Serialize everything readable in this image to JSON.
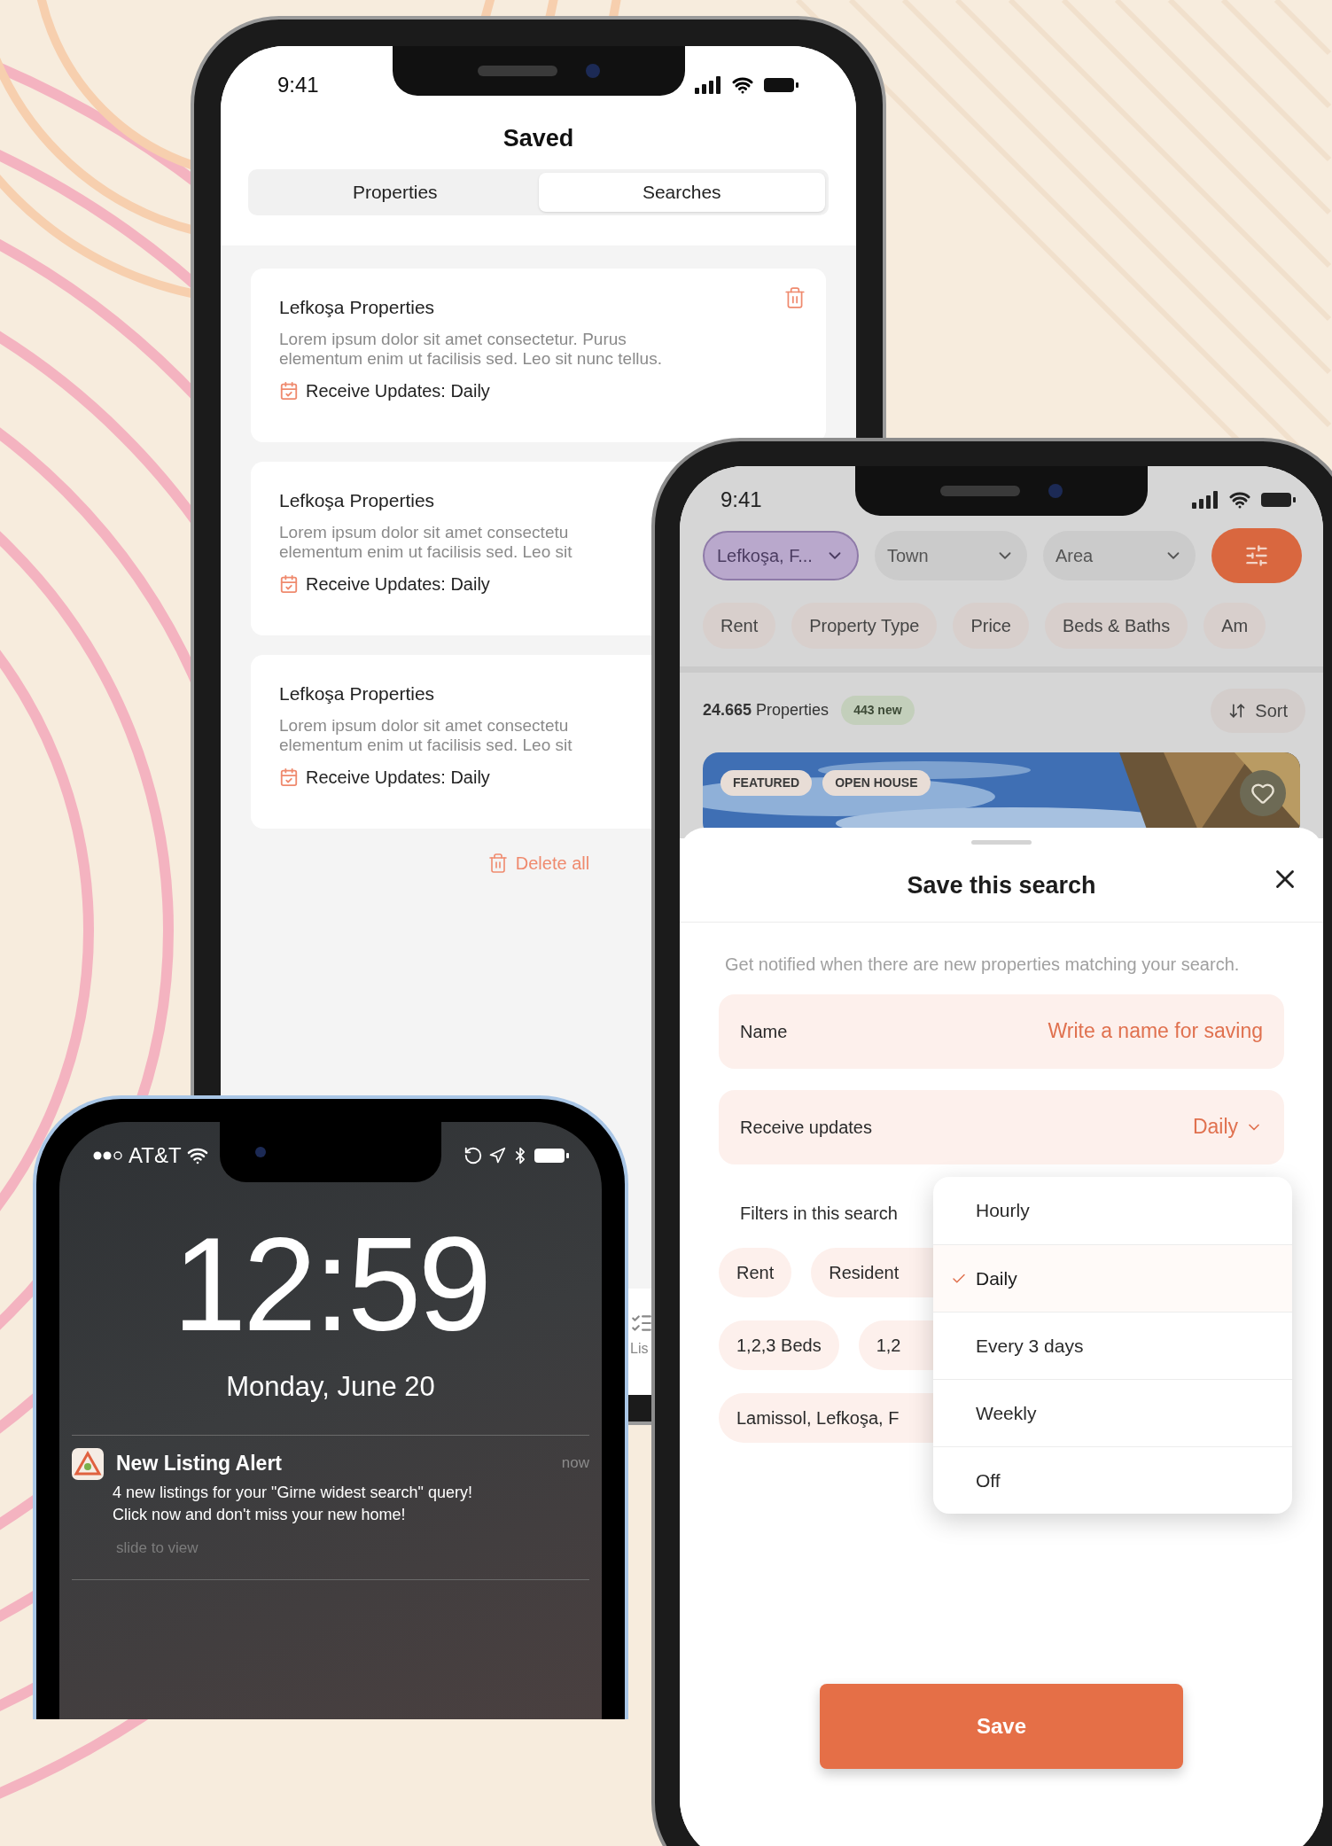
{
  "saved_phone": {
    "status_time": "9:41",
    "title": "Saved",
    "tabs": [
      {
        "label": "Properties",
        "selected": false
      },
      {
        "label": "Searches",
        "selected": true
      }
    ],
    "searches": [
      {
        "title": "Lefkoşa Properties",
        "description_lines": [
          "Lorem ipsum dolor sit amet consectetur. Purus",
          "elementum enim ut facilisis sed. Leo sit nunc tellus."
        ],
        "updates": "Receive Updates: Daily",
        "delete_icon": true
      },
      {
        "title": "Lefkoşa Properties",
        "description_lines": [
          "Lorem ipsum dolor sit amet consectetu",
          "elementum enim ut facilisis sed. Leo sit"
        ],
        "updates": "Receive Updates: Daily",
        "delete_icon": false
      },
      {
        "title": "Lefkoşa Properties",
        "description_lines": [
          "Lorem ipsum dolor sit amet consectetu",
          "elementum enim ut facilisis sed. Leo sit"
        ],
        "updates": "Receive Updates: Daily",
        "delete_icon": false
      }
    ],
    "delete_all": "Delete all",
    "tab_bar": [
      {
        "label": "Lis"
      }
    ]
  },
  "search_phone": {
    "status_time": "9:41",
    "location_filters": [
      {
        "label": "Lefkoşa, F...",
        "selected": true
      },
      {
        "label": "Town",
        "selected": false
      },
      {
        "label": "Area",
        "selected": false
      }
    ],
    "chips": [
      "Rent",
      "Property Type",
      "Price",
      "Beds & Baths",
      "Am"
    ],
    "count": "24.665",
    "count_label": "Properties",
    "new_badge": "443 new",
    "sort": "Sort",
    "listing_badges": [
      "FEATURED",
      "OPEN HOUSE"
    ],
    "sheet": {
      "title": "Save this search",
      "description": "Get notified when there are new properties matching your search.",
      "name_field": {
        "label": "Name",
        "placeholder": "Write a name for saving"
      },
      "updates_field": {
        "label": "Receive updates",
        "value": "Daily"
      },
      "filters_label": "Filters in this search",
      "filter_rows": [
        [
          "Rent",
          "Resident"
        ],
        [
          "1,2,3 Beds",
          "1,2"
        ],
        [
          "Lamissol, Lefkoşa, F"
        ]
      ],
      "save": "Save"
    },
    "dropdown": [
      {
        "label": "Hourly",
        "selected": false
      },
      {
        "label": "Daily",
        "selected": true
      },
      {
        "label": "Every 3 days",
        "selected": false
      },
      {
        "label": "Weekly",
        "selected": false
      },
      {
        "label": "Off",
        "selected": false
      }
    ]
  },
  "lock_phone": {
    "carrier": "AT&T",
    "time": "12:59",
    "date": "Monday, June 20",
    "notification": {
      "title": "New Listing Alert",
      "time": "now",
      "body_lines": [
        "4 new listings for your \"Girne widest search\" query!",
        "Click now and don't miss your new home!"
      ],
      "hint": "slide to view"
    }
  }
}
